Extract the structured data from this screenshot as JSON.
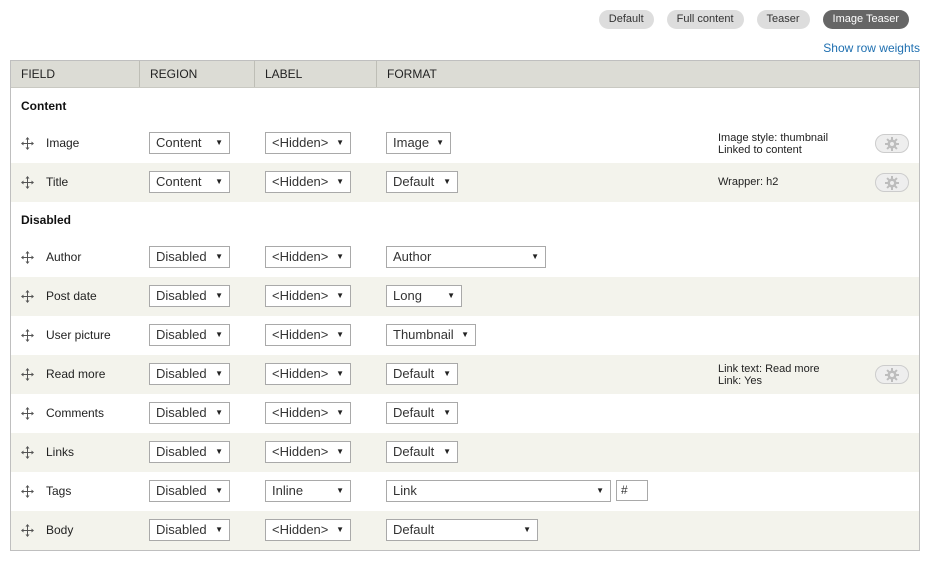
{
  "view_modes": [
    "Default",
    "Full content",
    "Teaser",
    "Image Teaser"
  ],
  "active_view_mode": "Image Teaser",
  "show_row_weights": "Show row weights",
  "columns": [
    "FIELD",
    "REGION",
    "LABEL",
    "FORMAT"
  ],
  "sections": {
    "content": "Content",
    "disabled": "Disabled"
  },
  "rows": [
    {
      "field": "Image",
      "region": "Content",
      "label": "<Hidden>",
      "format": "Image",
      "summary": [
        "Image style: thumbnail",
        "Linked to content"
      ]
    },
    {
      "field": "Title",
      "region": "Content",
      "label": "<Hidden>",
      "format": "Default",
      "summary": [
        "Wrapper: h2"
      ]
    },
    {
      "field": "Author",
      "region": "Disabled",
      "label": "<Hidden>",
      "format": "Author"
    },
    {
      "field": "Post date",
      "region": "Disabled",
      "label": "<Hidden>",
      "format": "Long"
    },
    {
      "field": "User picture",
      "region": "Disabled",
      "label": "<Hidden>",
      "format": "Thumbnail"
    },
    {
      "field": "Read more",
      "region": "Disabled",
      "label": "<Hidden>",
      "format": "Default",
      "summary": [
        "Link text: Read more",
        "Link: Yes"
      ]
    },
    {
      "field": "Comments",
      "region": "Disabled",
      "label": "<Hidden>",
      "format": "Default"
    },
    {
      "field": "Links",
      "region": "Disabled",
      "label": "<Hidden>",
      "format": "Default"
    },
    {
      "field": "Tags",
      "region": "Disabled",
      "label": "Inline",
      "format": "Link",
      "extra_input": "#"
    },
    {
      "field": "Body",
      "region": "Disabled",
      "label": "<Hidden>",
      "format": "Default"
    }
  ],
  "colors": {
    "link": "#1e6fb0",
    "active_tab": "#666666",
    "header": "#dcdcd5",
    "row_alt": "#f3f3ec"
  }
}
